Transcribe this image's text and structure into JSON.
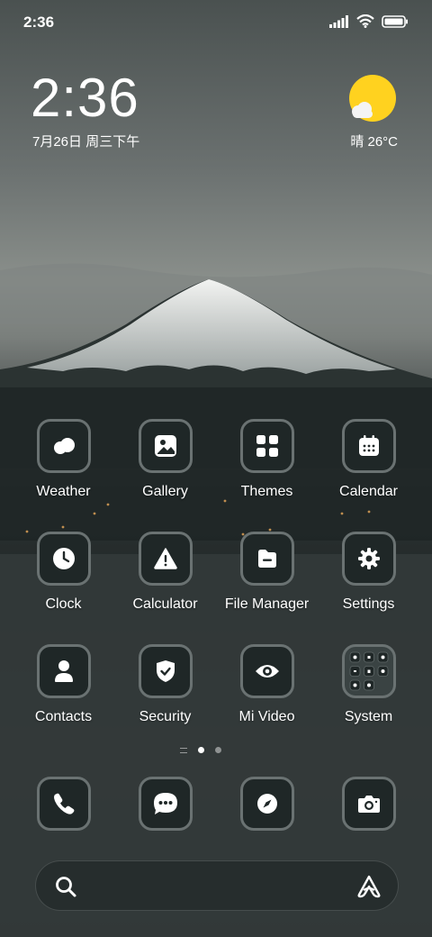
{
  "status_bar": {
    "time": "2:36"
  },
  "clock_widget": {
    "time": "2:36",
    "date": "7月26日 周三下午"
  },
  "weather_widget": {
    "text": "晴 26°C",
    "icon": "sun-cloud-icon",
    "sun_color": "#ffd21f"
  },
  "apps": [
    {
      "label": "Weather",
      "icon": "weather-icon"
    },
    {
      "label": "Gallery",
      "icon": "gallery-icon"
    },
    {
      "label": "Themes",
      "icon": "themes-icon"
    },
    {
      "label": "Calendar",
      "icon": "calendar-icon"
    },
    {
      "label": "Clock",
      "icon": "clock-icon"
    },
    {
      "label": "Calculator",
      "icon": "calculator-icon"
    },
    {
      "label": "File Manager",
      "icon": "file-manager-icon"
    },
    {
      "label": "Settings",
      "icon": "settings-icon"
    },
    {
      "label": "Contacts",
      "icon": "contacts-icon"
    },
    {
      "label": "Security",
      "icon": "security-icon"
    },
    {
      "label": "Mi Video",
      "icon": "mi-video-icon"
    },
    {
      "label": "System",
      "icon": "system-folder-icon"
    }
  ],
  "pager": {
    "pages": 2,
    "current": 1
  },
  "dock": [
    {
      "icon": "phone-icon"
    },
    {
      "icon": "messages-icon"
    },
    {
      "icon": "browser-icon"
    },
    {
      "icon": "camera-icon"
    }
  ],
  "search": {
    "icon": "search-icon",
    "assistant_icon": "assistant-icon"
  }
}
